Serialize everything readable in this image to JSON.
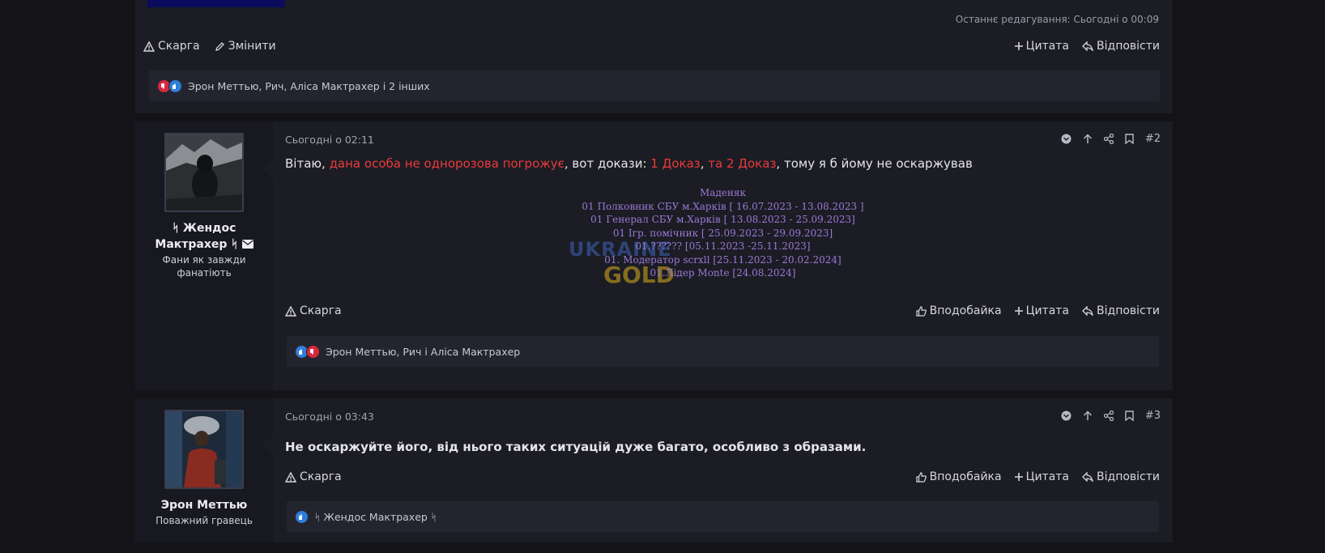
{
  "prev_post": {
    "edited": "Останнє редагування: Сьогодні о 00:09",
    "actions_left": [
      "Скарга",
      "Змінити"
    ],
    "actions_right": [
      "Цитата",
      "Відповісти"
    ],
    "reactions_text": "Эрон Меттью, Рич, Аліса Мактрахер і 2 інших"
  },
  "posts": [
    {
      "author": "ᛋ Жендос Мактрахер ᛋ",
      "user_title": "Фани як завжди фанатіють",
      "time": "Сьогодні о 02:11",
      "number": "#2",
      "content": {
        "p1": "Вітаю, ",
        "p2": "дана особа не однорозова погрожує",
        "p3": ", вот докази: ",
        "p4": "1 Доказ",
        "p5": ", ",
        "p6": "та 2 Доказ",
        "p7": ", тому я б йому не оскаржував"
      },
      "signature": [
        "Маденяк",
        "01 Полковник СБУ м.Харків [ 16.07.2023 - 13.08.2023 ]",
        "01 Генерал СБУ м.Харків [ 13.08.2023 - 25.09.2023]",
        "01 Ігр. помічник [ 25.09.2023 - 29.09.2023]",
        "01.?????? [05.11.2023 -25.11.2023]",
        "01. Модератор scrxll [25.11.2023 - 20.02.2024]",
        "01.Лідер Monte [24.08.2024]"
      ],
      "watermark": [
        "UKRAINE",
        "GOLD"
      ],
      "actions_left": [
        "Скарга"
      ],
      "actions_right": [
        "Вподобайка",
        "Цитата",
        "Відповісти"
      ],
      "reactions_text": "Эрон Меттью, Рич і Аліса Мактрахер"
    },
    {
      "author": "Эрон Меттью",
      "user_title": "Поважний гравець",
      "time": "Сьогодні о 03:43",
      "number": "#3",
      "content_bold": "Не оскаржуйте його, від нього таких ситуацій дуже багато, особливо з образами.",
      "actions_left": [
        "Скарга"
      ],
      "actions_right": [
        "Вподобайка",
        "Цитата",
        "Відповісти"
      ],
      "reactions_text": "ᛋ Жендос Мактрахер ᛋ"
    }
  ],
  "colors": {
    "background": "#131318",
    "panel": "#1c1c24",
    "sidebar": "#181820",
    "accent_red": "#e83b3b",
    "like_blue": "#2d7ed8",
    "signature_purple": "#9a79d6"
  }
}
